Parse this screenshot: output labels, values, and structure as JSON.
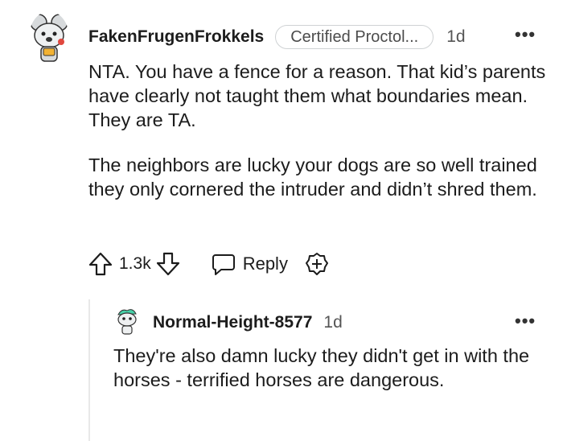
{
  "comments": [
    {
      "username": "FakenFrugenFrokkels",
      "flair": "Certified Proctol...",
      "time": "1d",
      "more_icon": "more-horizontal-icon",
      "paragraphs": [
        "NTA. You have a fence for a reason. That kid’s parents have clearly not taught them what boundaries mean. They are TA.",
        "The neighbors are lucky your dogs are so well trained they only cornered the intruder and didn’t shred them."
      ],
      "votes": "1.3k",
      "reply_label": "Reply",
      "icons": [
        "upvote-icon",
        "downvote-icon",
        "reply-icon",
        "award-icon"
      ]
    },
    {
      "username": "Normal-Height-8577",
      "time": "1d",
      "more_icon": "more-horizontal-icon",
      "text": "They're also damn lucky they didn't get in with the horses - terrified horses are dangerous."
    }
  ],
  "colors": {
    "text": "#1c1c1c",
    "muted": "#555555",
    "flair_border": "#cfd2d4",
    "thread_line": "#e8e8e8"
  }
}
